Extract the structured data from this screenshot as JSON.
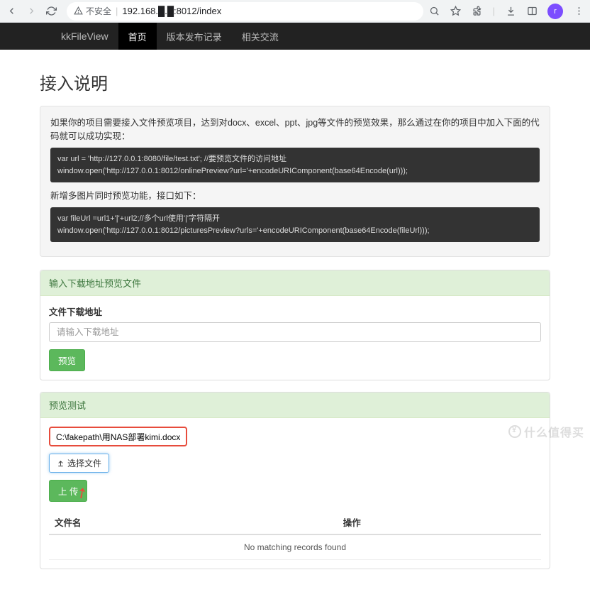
{
  "browser": {
    "insecure_label": "不安全",
    "url": "192.168.█.█:8012/index",
    "avatar_letter": "r"
  },
  "navbar": {
    "brand": "kkFileView",
    "items": [
      "首页",
      "版本发布记录",
      "相关交流"
    ],
    "active_index": 0
  },
  "page": {
    "title": "接入说明"
  },
  "instructions": {
    "intro": "如果你的项目需要接入文件预览项目，达到对docx、excel、ppt、jpg等文件的预览效果，那么通过在你的项目中加入下面的代码就可以成功实现：",
    "code1_line1": "var url = 'http://127.0.0.1:8080/file/test.txt'; //要预览文件的访问地址",
    "code1_line2": "window.open('http://127.0.0.1:8012/onlinePreview?url='+encodeURIComponent(base64Encode(url)));",
    "multi_label": "新增多图片同时预览功能，接口如下：",
    "code2_line1": "var fileUrl =url1+'|'+url2;//多个url使用'|'字符隔开",
    "code2_line2": "window.open('http://127.0.0.1:8012/picturesPreview?urls='+encodeURIComponent(base64Encode(fileUrl)));"
  },
  "preview_panel": {
    "heading": "输入下载地址预览文件",
    "label": "文件下载地址",
    "placeholder": "请输入下载地址",
    "button": "预览"
  },
  "test_panel": {
    "heading": "预览测试",
    "filepath": "C:\\fakepath\\用NAS部署kimi.docx",
    "choose_button": "选择文件",
    "upload_button": "上 传",
    "table": {
      "col1": "文件名",
      "col2": "操作",
      "empty": "No matching records found"
    }
  },
  "watermark": "什么值得买"
}
